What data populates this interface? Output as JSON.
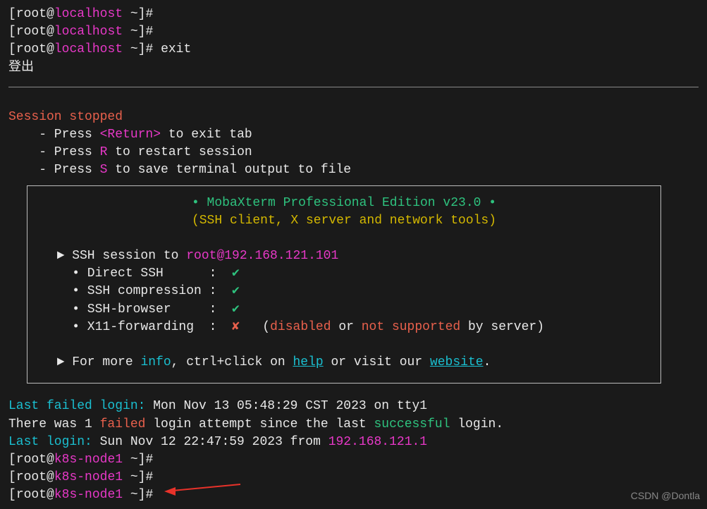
{
  "prompt": {
    "bracket_open": "[",
    "user": "root",
    "at": "@",
    "host_old": "localhost",
    "host_new": "k8s-node1",
    "path": " ~",
    "bracket_close": "]#",
    "exit_cmd": " exit"
  },
  "logout": "登出",
  "session": {
    "stopped": "Session stopped",
    "hint_return_a": "    - Press ",
    "hint_return_b": "<Return>",
    "hint_return_c": " to exit tab",
    "hint_r_a": "    - Press ",
    "hint_r_b": "R",
    "hint_r_c": " to restart session",
    "hint_s_a": "    - Press ",
    "hint_s_b": "S",
    "hint_s_c": " to save terminal output to file"
  },
  "box": {
    "title": "• MobaXterm Professional Edition v23.0 •",
    "subtitle": "(SSH client, X server and network tools)",
    "ssh_prefix": "  ► SSH session to ",
    "ssh_target": "root@192.168.121.101",
    "feat1": "    • Direct SSH      :  ",
    "feat2": "    • SSH compression :  ",
    "feat3": "    • SSH-browser     :  ",
    "feat4": "    • X11-forwarding  :  ",
    "check": "✔",
    "cross": "✘",
    "x11_a": "   (",
    "x11_b": "disabled",
    "x11_c": " or ",
    "x11_d": "not supported",
    "x11_e": " by server)",
    "more_a": "  ► For more ",
    "more_info": "info",
    "more_b": ", ctrl+click on ",
    "more_help": "help",
    "more_c": " or visit our ",
    "more_website": "website",
    "more_d": "."
  },
  "login": {
    "failed_label": "Last failed login:",
    "failed_time": " Mon Nov 13 05:48:29 CST 2023 on tty1",
    "attempt_a": "There was 1 ",
    "attempt_b": "failed",
    "attempt_c": " login attempt since the last ",
    "attempt_d": "successful",
    "attempt_e": " login.",
    "last_label": "Last login:",
    "last_time": " Sun Nov 12 22:47:59 2023 from ",
    "last_ip": "192.168.121.1"
  },
  "watermark": "CSDN @Dontla"
}
